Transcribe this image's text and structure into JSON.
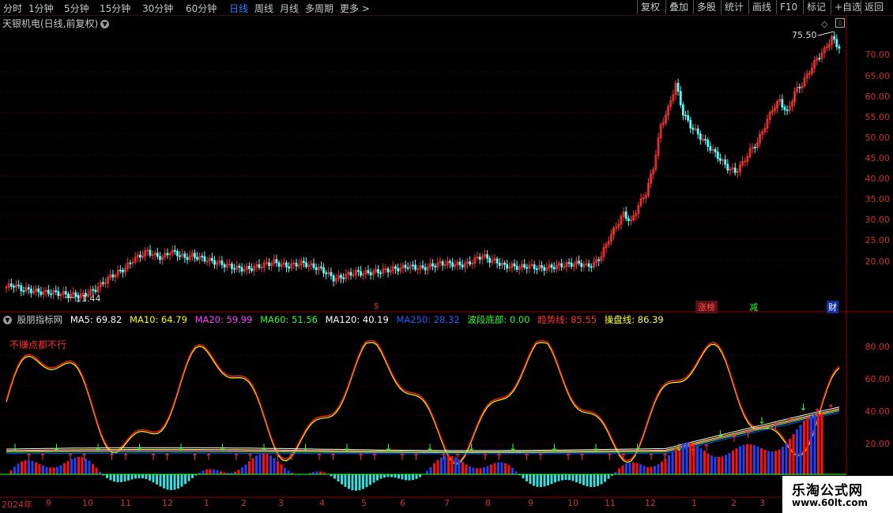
{
  "periods": [
    "分时",
    "1分钟",
    "5分钟",
    "15分钟",
    "30分钟",
    "60分钟",
    "日线",
    "周线",
    "月线",
    "多周期",
    "更多"
  ],
  "active_period": "日线",
  "right_buttons": [
    "复权",
    "叠加",
    "多股",
    "统计",
    "画线",
    "F10",
    "标记",
    "+自选",
    "返回"
  ],
  "stock_title": "天银机电(日线,前复权)",
  "price_axis": [
    "70.00",
    "65.00",
    "60.00",
    "55.00",
    "50.00",
    "45.00",
    "40.00",
    "35.00",
    "30.00",
    "25.00",
    "20.00"
  ],
  "max_label": "75.50",
  "min_label": "11.44",
  "tags": {
    "zhangbang": "涨榜",
    "jian": "减",
    "cai": "财",
    "s": "S"
  },
  "indicator": {
    "name": "股朋指标网",
    "ma5": "MA5: 69.82",
    "ma10": "MA10: 64.79",
    "ma20": "MA20: 59.99",
    "ma60": "MA60: 51.56",
    "ma120": "MA120: 40.19",
    "ma250": "MA250: 28.32",
    "bottom": "波段底部: 0.00",
    "trend": "趋势线: 85.55",
    "op": "操盘线: 86.39",
    "note": "不赚点都不行",
    "colors": {
      "ma5": "#ffffff",
      "ma10": "#ffff00",
      "ma20": "#ff00ff",
      "ma60": "#00ff00",
      "ma120": "#ffffff",
      "ma250": "#0050ff",
      "bottom": "#00ff00",
      "trend": "#ff2020",
      "op": "#ffff00"
    }
  },
  "indicator_axis": [
    "80.00",
    "60.00",
    "40.00",
    "20.00"
  ],
  "x_axis": [
    "2024年",
    "9",
    "10",
    "11",
    "12",
    "1",
    "2",
    "3",
    "4",
    "5",
    "6",
    "7",
    "8",
    "9",
    "10",
    "11",
    "12",
    "1",
    "2",
    "3"
  ],
  "watermark": {
    "line1": "乐淘公式网",
    "line2": "www.60lt.com"
  },
  "chart_data": {
    "type": "candlestick",
    "y_range": [
      11,
      76
    ],
    "closes": [
      13.5,
      14,
      13,
      12.8,
      12.5,
      12.2,
      12.3,
      12,
      11.8,
      11.6,
      11.44,
      12,
      13,
      14.5,
      16,
      17,
      18,
      20,
      21,
      22,
      21,
      20.5,
      22,
      21.5,
      20.5,
      21,
      20.5,
      20,
      19.5,
      19,
      18.5,
      18,
      17.8,
      18,
      18.5,
      19,
      19.5,
      18.8,
      18.5,
      19,
      19.2,
      18.5,
      18,
      17,
      15.5,
      15.8,
      16.5,
      17,
      16.8,
      17,
      17.2,
      17.5,
      17.8,
      18,
      18.5,
      18.2,
      18,
      18.5,
      19,
      19.2,
      19,
      18.8,
      19,
      20,
      21,
      20,
      19.5,
      18.5,
      18.5,
      18.2,
      18.5,
      18.3,
      18,
      18.2,
      18.5,
      18.8,
      19,
      19.2,
      18.5,
      19,
      21,
      25,
      28,
      31,
      29,
      33,
      36,
      42,
      52,
      56,
      62,
      55,
      52,
      50,
      48,
      46,
      44,
      42,
      41,
      43,
      46,
      48,
      52,
      56,
      58,
      55,
      60,
      62,
      65,
      68,
      70,
      73,
      70.5
    ]
  }
}
